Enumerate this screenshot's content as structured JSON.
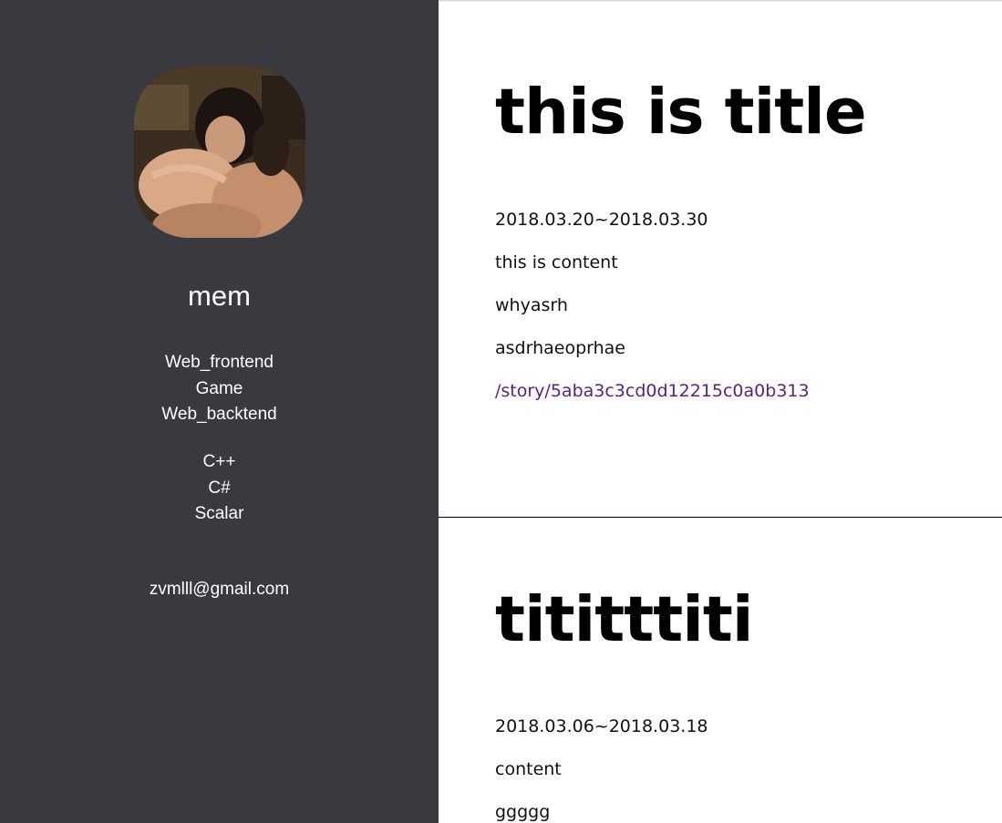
{
  "profile": {
    "name": "mem",
    "interests": [
      "Web_frontend",
      "Game",
      "Web_backtend"
    ],
    "languages": [
      "C++",
      "C#",
      "Scalar"
    ],
    "email": "zvmlll@gmail.com"
  },
  "posts": [
    {
      "title": "this is title",
      "date": "2018.03.20~2018.03.30",
      "lines": [
        "this is content",
        "whyasrh",
        "asdrhaeoprhae"
      ],
      "link": "/story/5aba3c3cd0d12215c0a0b313"
    },
    {
      "title": "tititttiti",
      "date": "2018.03.06~2018.03.18",
      "lines": [
        "content",
        "ggggg"
      ]
    }
  ],
  "colors": {
    "sidebar_bg": "#393a3f",
    "link": "#5a1e86"
  }
}
